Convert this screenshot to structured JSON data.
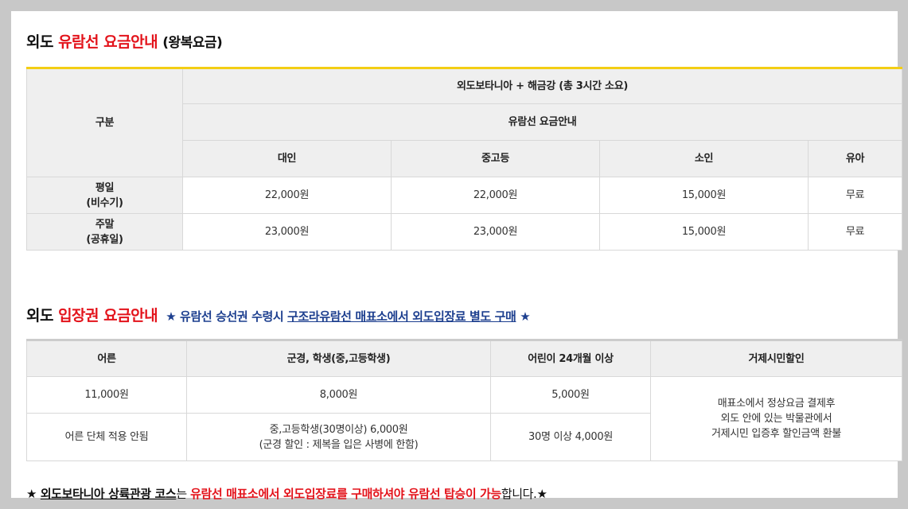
{
  "section1": {
    "title_prefix": "외도 ",
    "title_red": "유람선 요금안내",
    "title_suffix": "(왕복요금)",
    "header_route": "외도보타니아 + 해금강 (총 3시간 소요)",
    "header_sub": "유람선 요금안내",
    "col_category": "구분",
    "columns": [
      "대인",
      "중고등",
      "소인",
      "유아"
    ],
    "rows": [
      {
        "label_line1": "평일",
        "label_line2": "(비수기)",
        "values": [
          "22,000원",
          "22,000원",
          "15,000원",
          "무료"
        ]
      },
      {
        "label_line1": "주말",
        "label_line2": "(공휴일)",
        "values": [
          "23,000원",
          "23,000원",
          "15,000원",
          "무료"
        ]
      }
    ]
  },
  "section2": {
    "title_prefix": "외도 ",
    "title_red": "입장권 요금안내",
    "notice_star_left": "★ 유람선 승선권 수령시 ",
    "notice_underlined": "구조라유람선 매표소에서 외도입장료 별도 구매",
    "notice_star_right": " ★",
    "columns": [
      "어른",
      "군경, 학생(중,고등학생)",
      "어린이 24개월 이상",
      "거제시민할인"
    ],
    "row1": [
      "11,000원",
      "8,000원",
      "5,000원"
    ],
    "row2_col1": "어른 단체 적용 안됨",
    "row2_col2_line1": "중,고등학생(30명이상) 6,000원",
    "row2_col2_line2": "(군경 할인 : 제복을 입은 사병에 한함)",
    "row2_col3": "30명 이상 4,000원",
    "discount_line1": "매표소에서 정상요금 결제후",
    "discount_line2": "외도 안에 있는 박물관에서",
    "discount_line3": "거제시민 입증후 할인금액 환불"
  },
  "bottom_notice": {
    "star_left": "★ ",
    "underlined": "외도보타니아 상륙관광 코스",
    "part2": "는 ",
    "red": "유람선 매표소에서 외도입장료를 구매하셔야 유람선 탑승이 가능",
    "part3": "합니다.",
    "star_right": "★"
  }
}
